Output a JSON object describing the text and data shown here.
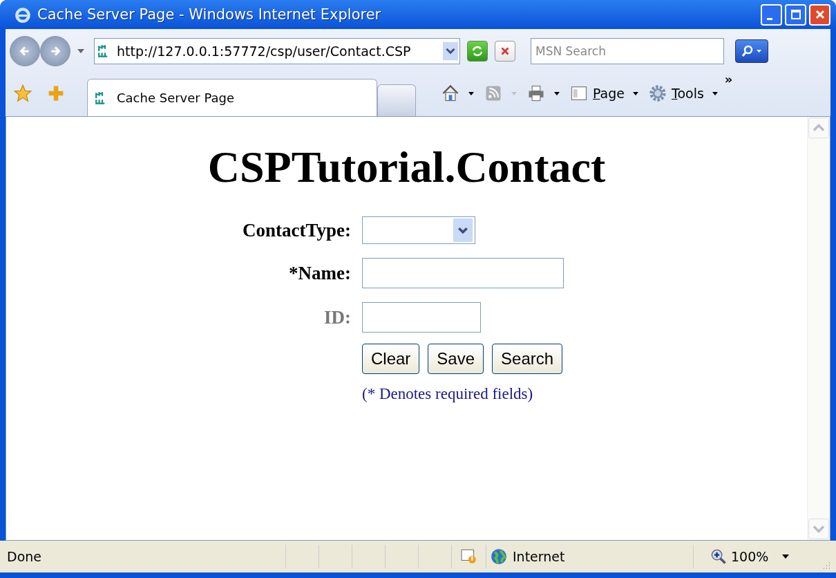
{
  "window": {
    "title": "Cache Server Page - Windows Internet Explorer"
  },
  "address_bar": {
    "url": "http://127.0.0.1:57772/csp/user/Contact.CSP"
  },
  "search": {
    "placeholder": "MSN Search"
  },
  "tabs": [
    {
      "label": "Cache Server Page",
      "selected": true
    }
  ],
  "overflow_chevron": "»",
  "command_bar": [
    {
      "kind": "home"
    },
    {
      "kind": "feeds",
      "disabled": true
    },
    {
      "kind": "print"
    },
    {
      "kind": "menu",
      "label": "Page",
      "underline_first": true
    },
    {
      "kind": "menu",
      "label": "Tools",
      "underline_first": true
    }
  ],
  "page": {
    "heading": "CSPTutorial.Contact",
    "fields": [
      {
        "label": "ContactType:",
        "kind": "select",
        "dimmed": false
      },
      {
        "label": "*Name:",
        "kind": "widetext",
        "dimmed": false
      },
      {
        "label": "ID:",
        "kind": "narrowtext",
        "dimmed": true
      }
    ],
    "buttons": [
      "Clear",
      "Save",
      "Search"
    ],
    "note": "(* Denotes required fields)"
  },
  "status_bar": {
    "text": "Done",
    "zone": "Internet",
    "zoom": "100%"
  }
}
